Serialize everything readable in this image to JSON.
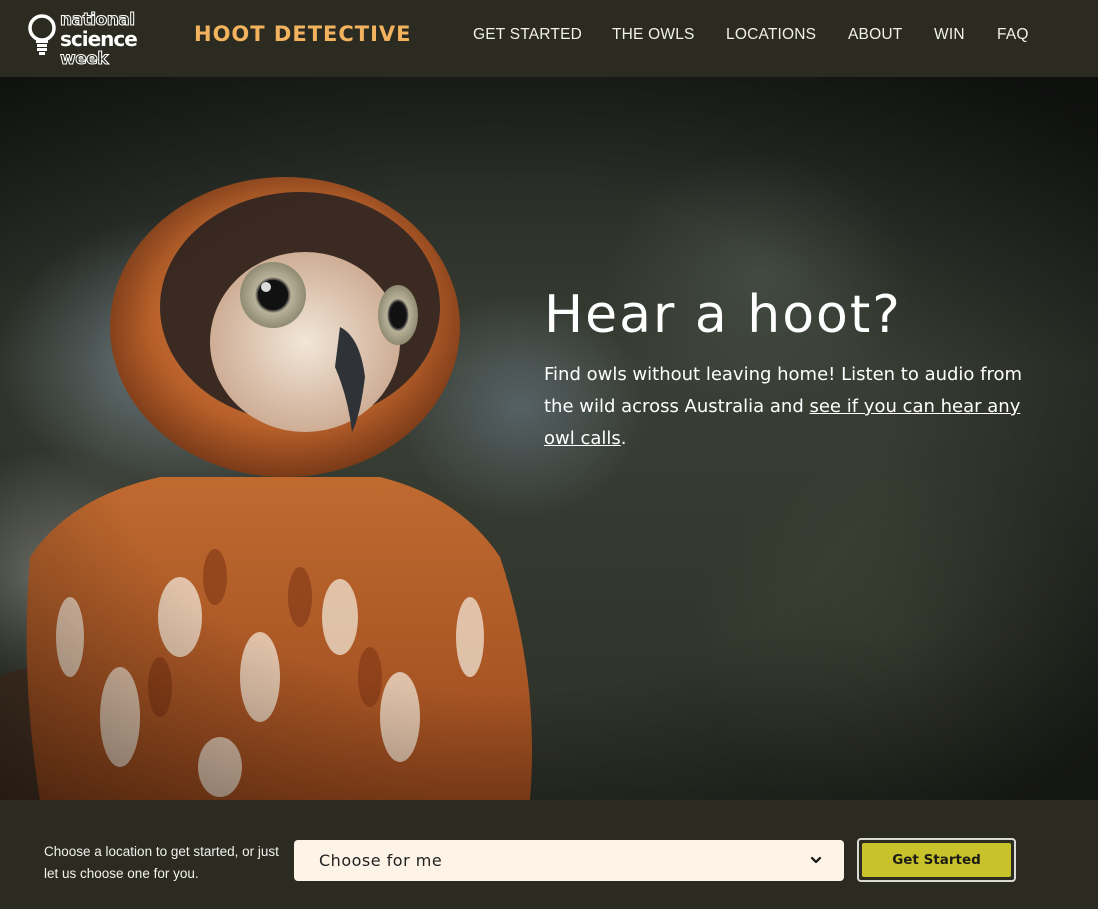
{
  "header": {
    "logo_text": [
      "national",
      "science",
      "week"
    ],
    "site_title": "HOOT DETECTIVE",
    "nav": [
      {
        "label": "GET STARTED"
      },
      {
        "label": "THE OWLS"
      },
      {
        "label": "LOCATIONS"
      },
      {
        "label": "ABOUT"
      },
      {
        "label": "WIN"
      },
      {
        "label": "FAQ"
      }
    ]
  },
  "hero": {
    "title": "Hear a hoot?",
    "desc_before": "Find owls without leaving home! Listen to audio from the wild across Australia and ",
    "desc_link": "see if you can hear any owl calls",
    "desc_after": "."
  },
  "footer": {
    "prompt": "Choose a location to get started, or just let us choose one for you.",
    "select_value": "Choose for me",
    "button_label": "Get Started"
  },
  "colors": {
    "header_bg": "#2c2b21",
    "title_accent": "#f2b25e",
    "button_bg": "#c8c32a",
    "select_bg": "#fdf3e7"
  }
}
